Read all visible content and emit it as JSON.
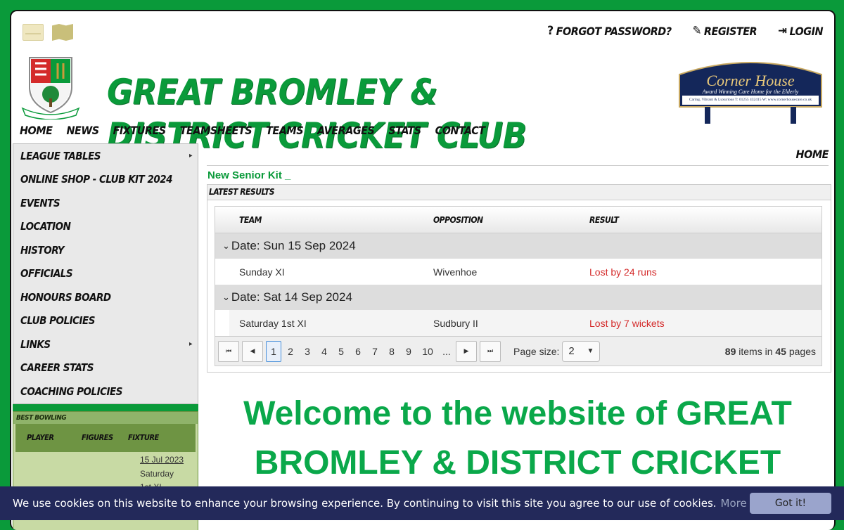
{
  "account_links": [
    {
      "glyph": "?",
      "label": "FORGOT PASSWORD?"
    },
    {
      "glyph": "✎",
      "label": "REGISTER"
    },
    {
      "glyph": "⇥",
      "label": "LOGIN"
    }
  ],
  "club_title": "GREAT BROMLEY & DISTRICT CRICKET CLUB",
  "sponsor": {
    "name": "Corner House",
    "tagline": "Award Winning Care Home for the Elderly",
    "details": "Caring, Vibrant & Luxurious  T: 01255 432415  W: www.cornerhousecare.co.uk"
  },
  "nav": [
    "HOME",
    "NEWS",
    "FIXTURES",
    "TEAMSHEETS",
    "TEAMS",
    "AVERAGES",
    "STATS",
    "CONTACT"
  ],
  "sidebar": [
    {
      "label": "LEAGUE TABLES",
      "has_sub": "▸"
    },
    {
      "label": "ONLINE SHOP - CLUB KIT 2024",
      "has_sub": ""
    },
    {
      "label": "EVENTS",
      "has_sub": ""
    },
    {
      "label": "LOCATION",
      "has_sub": ""
    },
    {
      "label": "HISTORY",
      "has_sub": ""
    },
    {
      "label": "OFFICIALS",
      "has_sub": ""
    },
    {
      "label": "HONOURS BOARD",
      "has_sub": ""
    },
    {
      "label": "CLUB POLICIES",
      "has_sub": ""
    },
    {
      "label": "LINKS",
      "has_sub": "▸"
    },
    {
      "label": "CAREER STATS",
      "has_sub": ""
    },
    {
      "label": "COACHING POLICIES",
      "has_sub": ""
    }
  ],
  "best_bowling": {
    "title": "BEST BOWLING",
    "headers": [
      "PLAYER",
      "FIGURES",
      "FIXTURE"
    ],
    "row": {
      "date": "15 Jul 2023",
      "team": "Saturday",
      "team2": "1st XI"
    }
  },
  "breadcrumb": "HOME",
  "news_link": "New Senior Kit _",
  "results": {
    "title": "LATEST RESULTS",
    "headers": [
      "TEAM",
      "OPPOSITION",
      "RESULT"
    ],
    "groups": [
      {
        "date": "Date: Sun 15 Sep 2024",
        "team": "Sunday XI",
        "opposition": "Wivenhoe",
        "result": "Lost by 24 runs"
      },
      {
        "date": "Date: Sat 14 Sep 2024",
        "team": "Saturday 1st XI",
        "opposition": "Sudbury II",
        "result": "Lost by 7 wickets"
      }
    ],
    "pager": {
      "pages": [
        "1",
        "2",
        "3",
        "4",
        "5",
        "6",
        "7",
        "8",
        "9",
        "10",
        "..."
      ],
      "page_size_label": "Page size:",
      "page_size": "2",
      "items": "89",
      "items_label": "items in",
      "page_count": "45",
      "pages_label": "pages"
    }
  },
  "welcome": "Welcome to the website of GREAT BROMLEY & DISTRICT CRICKET",
  "cookie": {
    "text": "We use cookies on this website to enhance your browsing experience. By continuing to visit this site you agree to our use of cookies.",
    "more": "More info",
    "button": "Got it!"
  },
  "colors": {
    "brand_green": "#0a9a3a",
    "cookie_bg": "#23295a",
    "loss_red": "#d42a2a"
  }
}
